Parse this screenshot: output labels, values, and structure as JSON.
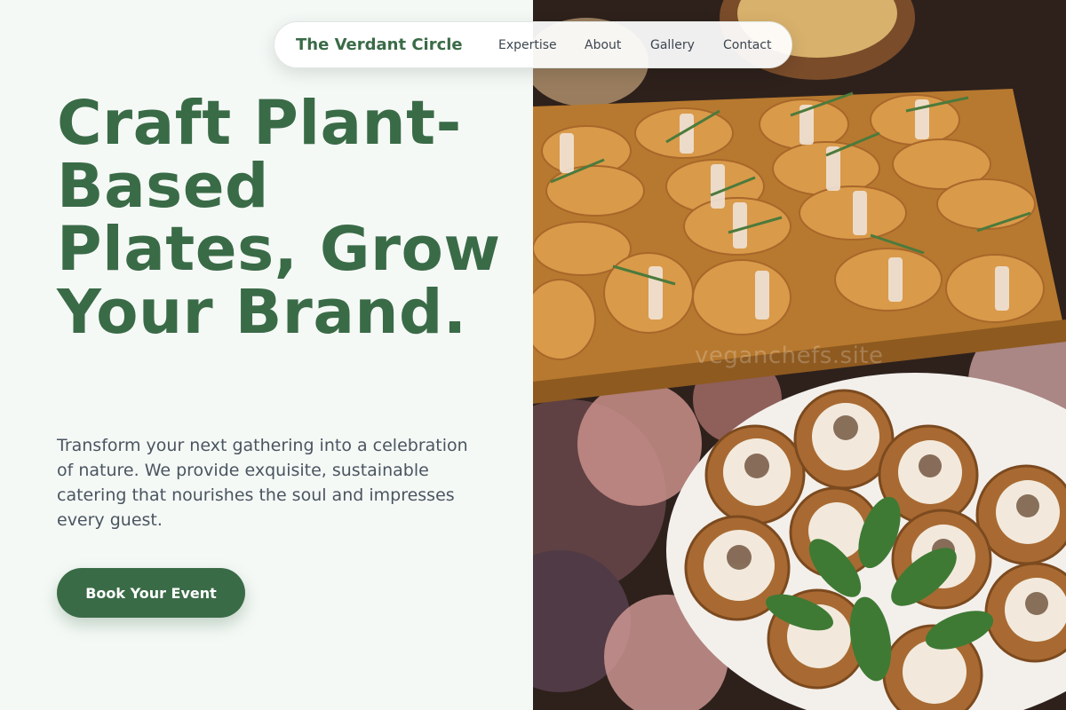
{
  "nav": {
    "brand": "The Verdant Circle",
    "links": [
      "Expertise",
      "About",
      "Gallery",
      "Contact"
    ]
  },
  "hero": {
    "title": "Craft Plant-Based Plates, Grow Your Brand.",
    "subtitle": "Transform your next gathering into a celebration of nature. We provide exquisite, sustainable catering that nourishes the soul and impresses every guest.",
    "cta_label": "Book Your Event"
  },
  "image": {
    "watermark": "veganchefs.site"
  },
  "colors": {
    "brand_green": "#3a6b47",
    "page_bg": "#f5f9f6",
    "body_text": "#4a5560"
  }
}
